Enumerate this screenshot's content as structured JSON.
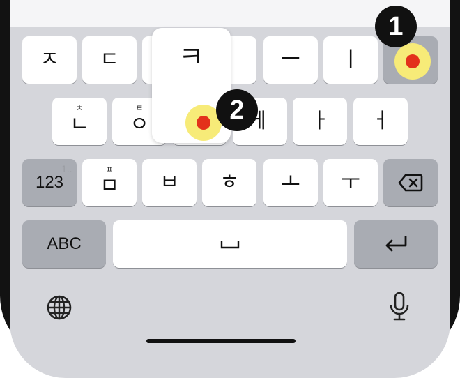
{
  "keyboard": {
    "row1": [
      "ㅈ",
      "ㄷ",
      "ㅋ",
      "ㅡ",
      "ㅣ"
    ],
    "row2": [
      {
        "main": "ㄴ",
        "sub": "ㅊ"
      },
      {
        "main": "ㅇ",
        "sub": "ㅌ"
      },
      {
        "main": "ㅔ",
        "sub": ""
      },
      {
        "main": "ㅏ",
        "sub": ""
      },
      {
        "main": "ㅓ",
        "sub": ""
      }
    ],
    "row3": [
      {
        "main": "ㅁ",
        "sub": "ㅍ"
      },
      {
        "main": "ㅂ",
        "sub": ""
      },
      {
        "main": "ㅎ",
        "sub": ""
      },
      {
        "main": "ㅗ",
        "sub": ""
      },
      {
        "main": "ㅜ",
        "sub": ""
      }
    ],
    "numbers_label": "123",
    "numbers_hint": "1..",
    "abc_label": "ABC",
    "space_glyph": "⎵",
    "popup_glyph": "ㅋ"
  },
  "annotations": {
    "badge1": "1",
    "badge2": "2"
  },
  "icons": {
    "backspace": "backspace-icon",
    "return": "return-icon",
    "globe": "globe-icon",
    "mic": "microphone-icon"
  },
  "colors": {
    "key": "#ffffff",
    "key_dark": "#a9acb3",
    "keyboard_bg": "#d5d6db",
    "tap_outer": "#f7eb78",
    "tap_inner": "#e3311b"
  }
}
